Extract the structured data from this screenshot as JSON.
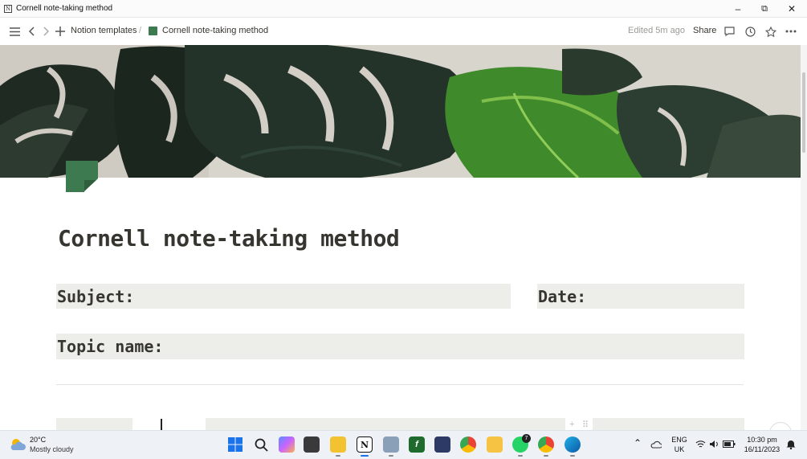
{
  "window": {
    "title": "Cornell note-taking method",
    "minimize": "–",
    "restore": "⧉",
    "close": "✕"
  },
  "topbar": {
    "breadcrumb_parent": "Notion templates",
    "breadcrumb_sep": "/",
    "breadcrumb_current": "Cornell note-taking method",
    "edited": "Edited 5m ago",
    "share": "Share"
  },
  "page": {
    "title": "Cornell note-taking method",
    "fields": {
      "subject": "Subject:",
      "date": "Date:",
      "topic": "Topic name:"
    }
  },
  "taskbar": {
    "weather_temp": "20°C",
    "weather_desc": "Mostly cloudy",
    "whatsapp_badge": "7",
    "lang_top": "ENG",
    "lang_bottom": "UK",
    "time": "10:30 pm",
    "date": "16/11/2023"
  },
  "colors": {
    "field_bg": "#edeeea",
    "page_icon": "#3e7a4f",
    "text": "#37352f",
    "muted": "#9b9a97"
  }
}
